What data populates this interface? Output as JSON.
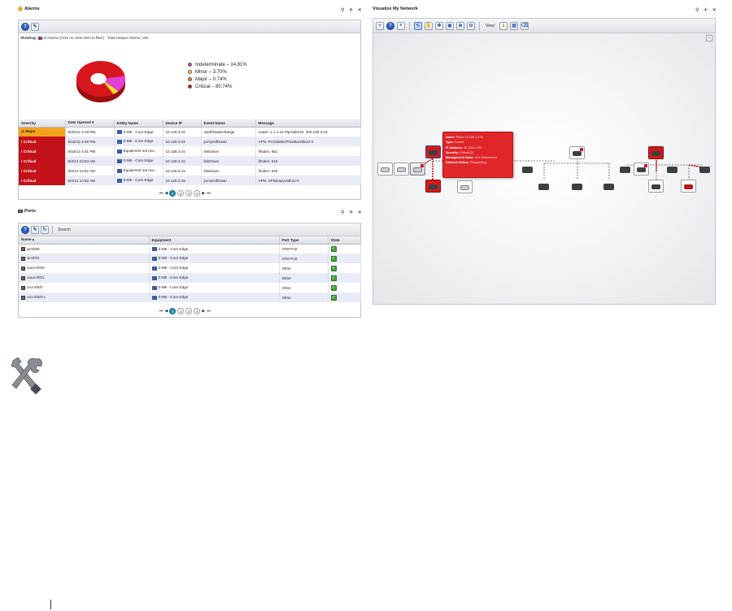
{
  "alarms": {
    "title": "Alarms",
    "controls": "⚲ ✛ ✕",
    "showing_label": "Showing:",
    "showing_text": "All Alarms (click on chart slice to filter) - Total Unique Alarms: 135",
    "legend": [
      {
        "label": "Indeterminate – 14.81%",
        "color": "#e23fd5"
      },
      {
        "label": "Minor – 3.70%",
        "color": "#f2e12a"
      },
      {
        "label": "Major – 0.74%",
        "color": "#e8861b"
      },
      {
        "label": "Critical – 80.74%",
        "color": "#d8171c"
      }
    ],
    "columns": [
      "Severity",
      "Date Opened ▾",
      "Entity Name",
      "Device IP",
      "Event Name",
      "Message"
    ],
    "rows": [
      {
        "severity": "Major",
        "sev_class": "major",
        "date": "6/20/12 3:18 PM",
        "entity": "Z-M5 - Core Edge",
        "ip": "10.128.3.15",
        "event": "ospfIfStateChange",
        "message": "router: 1.1.1.15 IfIpAddress: 200.128.3.15"
      },
      {
        "severity": "Critical",
        "sev_class": "critical",
        "date": "6/15/12 4:08 PM",
        "entity": "Z-M5 - Core Edge",
        "ip": "10.128.3.15",
        "event": "jnxVpnIfDown",
        "message": "VPN: PV15580VPN1Mar30b12-h"
      },
      {
        "severity": "Critical",
        "sev_class": "critical",
        "date": "6/15/12 4:01 PM",
        "entity": "Equipment not ma...",
        "ip": "10.128.3.10",
        "event": "linkDown",
        "message": "ifIndex: 551"
      },
      {
        "severity": "Critical",
        "sev_class": "critical",
        "date": "6/2/12 10:53 AM",
        "entity": "Z-M5 - Core Edge",
        "ip": "10.128.3.15",
        "event": "linkDown",
        "message": "ifIndex: 615"
      },
      {
        "severity": "Critical",
        "sev_class": "critical",
        "date": "6/2/12 10:52 AM",
        "entity": "Equipment not ma...",
        "ip": "10.128.3.15",
        "event": "linkDown",
        "message": "ifIndex: 636"
      },
      {
        "severity": "Critical",
        "sev_class": "critical",
        "date": "6/2/12 10:52 AM",
        "entity": "Z-M5 - Core Edge",
        "ip": "10.128.3.15",
        "event": "jnxVpnIfDown",
        "message": "VPN: VPN3July18th12-h"
      }
    ],
    "pages": [
      "1",
      "2",
      "3",
      "4"
    ]
  },
  "ports": {
    "title": "Ports",
    "controls": "⚲ ✛ ✕",
    "search_label": "Search",
    "columns": [
      "Name ▴",
      "Equipment",
      "Port Type",
      "State"
    ],
    "rows": [
      {
        "name": "at-0/0/0",
        "equipment": "Z-M5 - Core Edge",
        "type": "ATM Port"
      },
      {
        "name": "at-0/0/1",
        "equipment": "Z-M5 - Core Edge",
        "type": "ATM Port"
      },
      {
        "name": "cau4-0/0/0",
        "equipment": "Z-M5 - Core Edge",
        "type": "Other"
      },
      {
        "name": "cau4-0/0/1",
        "equipment": "Z-M5 - Core Edge",
        "type": "Other"
      },
      {
        "name": "ce1-0/0/0",
        "equipment": "Z-M5 - Core Edge",
        "type": "Other"
      },
      {
        "name": "ce1-0/0/0:1",
        "equipment": "Z-M5 - Core Edge",
        "type": "Other"
      }
    ],
    "pages": [
      "1",
      "2",
      "3",
      "4"
    ]
  },
  "network": {
    "title": "Visualize My Network",
    "controls": "⚲ ✛ ✕",
    "view_label": "View:",
    "collapse": "«",
    "tooltip": [
      {
        "k": "Name:",
        "v": "Radio 10.128.2.130"
      },
      {
        "k": "Type:",
        "v": "Router"
      },
      {
        "k": "IP Address:",
        "v": "10.128.2.130"
      },
      {
        "k": "Severity:",
        "v": "Critical (2)"
      },
      {
        "k": "Management State:",
        "v": "Not Determined"
      },
      {
        "k": "Network Status:",
        "v": "Responding"
      }
    ]
  },
  "pie": {
    "type": "pie",
    "slices": [
      {
        "label": "Indeterminate",
        "value": 14.81,
        "color": "#e23fd5"
      },
      {
        "label": "Minor",
        "value": 3.7,
        "color": "#f2e12a"
      },
      {
        "label": "Major",
        "value": 0.74,
        "color": "#e8861b"
      },
      {
        "label": "Critical",
        "value": 80.74,
        "color": "#d8171c"
      }
    ]
  }
}
